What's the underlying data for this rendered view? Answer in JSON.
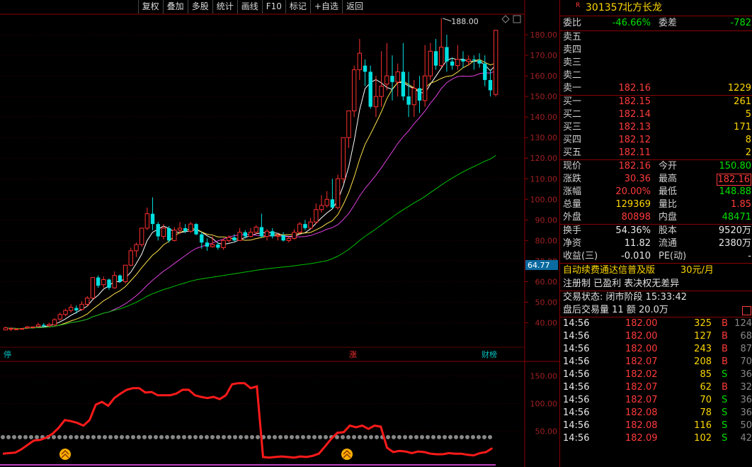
{
  "toolbar": [
    "复权",
    "叠加",
    "多股",
    "统计",
    "画线",
    "F10",
    "标记",
    "+自选",
    "返回"
  ],
  "chart": {
    "y_labels": [
      "180.00",
      "170.00",
      "160.00",
      "150.00",
      "140.00",
      "130.00",
      "120.00",
      "110.00",
      "100.00",
      "90.00",
      "80.00",
      "70.00",
      "60.00",
      "50.00",
      "40.00"
    ],
    "high_label": "188.00",
    "cur_price_tag": "64.77",
    "markers": {
      "stop": "停",
      "zhang": "涨",
      "caibang": "财榜"
    },
    "indicator_labels": [
      "150.00",
      "100.00",
      "50.00"
    ]
  },
  "chart_data": {
    "type": "candlestick",
    "ylim": [
      35,
      190
    ],
    "candles": [
      [
        36.5,
        37.5,
        36.8,
        38.2
      ],
      [
        36.8,
        37.2,
        36.0,
        37.8
      ],
      [
        37.0,
        37.0,
        36.5,
        37.4
      ],
      [
        37.2,
        37.2,
        37.2,
        37.2
      ],
      [
        37.5,
        38.0,
        37.2,
        38.5
      ],
      [
        38.0,
        38.0,
        38.0,
        38.0
      ],
      [
        38.2,
        39.0,
        37.8,
        40.0
      ],
      [
        39.0,
        38.5,
        37.5,
        39.8
      ],
      [
        38.6,
        39.2,
        38.0,
        40.0
      ],
      [
        39.0,
        41.5,
        38.5,
        42.3
      ],
      [
        41.8,
        44.0,
        41.0,
        45.0
      ],
      [
        44.0,
        46.0,
        43.2,
        46.8
      ],
      [
        46.0,
        47.5,
        45.0,
        49.0
      ],
      [
        47.2,
        46.0,
        44.5,
        48.5
      ],
      [
        46.5,
        49.0,
        45.8,
        50.5
      ],
      [
        49.0,
        52.0,
        48.0,
        53.0
      ],
      [
        52.0,
        62.0,
        51.5,
        62.0
      ],
      [
        62.0,
        58.0,
        57.0,
        63.0
      ],
      [
        58.5,
        61.0,
        57.0,
        62.5
      ],
      [
        61.0,
        57.0,
        56.0,
        61.5
      ],
      [
        57.0,
        63.0,
        56.5,
        65.0
      ],
      [
        63.0,
        60.0,
        59.5,
        63.5
      ],
      [
        60.0,
        68.0,
        59.0,
        68.0
      ],
      [
        68.0,
        75.0,
        67.5,
        76.5
      ],
      [
        75.0,
        78.0,
        72.0,
        79.0
      ],
      [
        78.0,
        86.0,
        77.0,
        86.0
      ],
      [
        86.0,
        93.0,
        85.0,
        96.0
      ],
      [
        93.0,
        88.0,
        85.0,
        101.0
      ],
      [
        88.0,
        82.0,
        80.0,
        89.0
      ],
      [
        82.0,
        86.0,
        80.5,
        88.0
      ],
      [
        86.0,
        80.0,
        79.0,
        87.0
      ],
      [
        80.0,
        85.0,
        79.5,
        86.5
      ],
      [
        85.0,
        86.0,
        83.0,
        89.0
      ],
      [
        86.0,
        84.5,
        83.5,
        88.0
      ],
      [
        84.5,
        88.0,
        83.8,
        89.0
      ],
      [
        88.0,
        83.0,
        82.5,
        88.5
      ],
      [
        83.0,
        79.0,
        76.0,
        84.0
      ],
      [
        79.0,
        77.0,
        75.0,
        81.0
      ],
      [
        77.0,
        78.0,
        76.5,
        82.0
      ],
      [
        78.0,
        76.5,
        75.5,
        79.0
      ],
      [
        76.5,
        80.0,
        75.5,
        81.0
      ],
      [
        80.0,
        81.5,
        79.0,
        82.5
      ],
      [
        81.5,
        80.0,
        79.5,
        83.0
      ],
      [
        80.0,
        84.0,
        79.8,
        86.0
      ],
      [
        84.0,
        82.0,
        81.0,
        85.0
      ],
      [
        82.0,
        84.0,
        81.5,
        86.0
      ],
      [
        84.0,
        86.5,
        83.0,
        87.5
      ],
      [
        86.5,
        82.0,
        81.5,
        93.0
      ],
      [
        82.0,
        84.5,
        80.0,
        85.5
      ],
      [
        84.5,
        82.0,
        81.0,
        86.0
      ],
      [
        82.0,
        82.5,
        80.0,
        83.5
      ],
      [
        82.5,
        80.0,
        79.5,
        84.0
      ],
      [
        80.0,
        81.0,
        79.0,
        82.0
      ],
      [
        81.0,
        84.0,
        80.5,
        85.5
      ],
      [
        84.0,
        88.0,
        83.0,
        89.0
      ],
      [
        88.0,
        86.0,
        85.0,
        90.0
      ],
      [
        86.0,
        89.0,
        85.5,
        91.0
      ],
      [
        89.0,
        95.0,
        88.0,
        98.0
      ],
      [
        95.0,
        97.0,
        93.5,
        102.0
      ],
      [
        97.0,
        100.0,
        96.0,
        104.0
      ],
      [
        100.0,
        96.0,
        95.5,
        110.0
      ],
      [
        96.0,
        110.0,
        95.0,
        112.0
      ],
      [
        110.0,
        130.0,
        108.0,
        130.0
      ],
      [
        130.0,
        143.0,
        125.0,
        143.0
      ],
      [
        143.0,
        163.0,
        140.0,
        165.0
      ],
      [
        163.0,
        171.0,
        158.0,
        178.0
      ],
      [
        165.0,
        162.0,
        155.0,
        168.0
      ],
      [
        162.0,
        145.0,
        144.0,
        165.0
      ],
      [
        145.0,
        150.0,
        140.0,
        160.0
      ],
      [
        150.0,
        155.0,
        145.0,
        172.0
      ],
      [
        156.0,
        160.0,
        153.0,
        176.0
      ],
      [
        160.0,
        157.0,
        148.0,
        170.0
      ],
      [
        157.0,
        162.0,
        150.0,
        166.0
      ],
      [
        162.0,
        150.0,
        148.0,
        176.0
      ],
      [
        150.0,
        146.0,
        140.0,
        162.0
      ],
      [
        146.0,
        154.0,
        140.0,
        158.0
      ],
      [
        154.0,
        148.0,
        142.0,
        160.0
      ],
      [
        148.0,
        160.0,
        145.0,
        175.0
      ],
      [
        160.0,
        172.0,
        158.0,
        176.0
      ],
      [
        172.0,
        165.0,
        163.0,
        178.0
      ],
      [
        165.0,
        174.0,
        164.0,
        188.0
      ],
      [
        174.0,
        167.0,
        162.0,
        180.0
      ],
      [
        167.0,
        165.0,
        163.0,
        169.0
      ],
      [
        165.0,
        168.0,
        163.0,
        175.0
      ],
      [
        168.0,
        167.0,
        164.0,
        172.0
      ],
      [
        167.0,
        168.0,
        165.0,
        170.0
      ],
      [
        168.0,
        167.5,
        163.0,
        170.0
      ],
      [
        167.5,
        166.0,
        164.0,
        171.0
      ],
      [
        166.0,
        158.0,
        155.0,
        170.0
      ],
      [
        158.0,
        153.0,
        150.0,
        163.0
      ],
      [
        151.0,
        182.16,
        150.0,
        182.16
      ]
    ],
    "indicator": [
      9,
      10,
      11,
      17,
      25,
      33,
      34,
      38,
      45,
      56,
      70,
      68,
      65,
      60,
      70,
      98,
      103,
      96,
      110,
      118,
      125,
      128,
      128,
      120,
      121,
      115,
      115,
      115,
      118,
      125,
      125,
      115,
      112,
      110,
      112,
      108,
      115,
      135,
      137,
      137,
      128,
      131,
      3,
      2,
      3,
      4,
      3,
      2,
      4,
      3,
      5,
      9,
      22,
      36,
      47,
      48,
      60,
      57,
      60,
      54,
      60,
      58,
      20,
      12,
      14,
      13,
      10,
      13,
      12,
      9,
      8,
      8,
      10,
      9,
      9,
      7,
      6,
      10,
      12,
      19
    ]
  },
  "side": {
    "code": "301357",
    "name": "北方长龙",
    "r_badge": "R",
    "weibi_label": "委比",
    "weibi": "-46.66%",
    "weicha_label": "委差",
    "weicha": "-782",
    "asks": [
      {
        "label": "卖五",
        "price": "",
        "vol": ""
      },
      {
        "label": "卖四",
        "price": "",
        "vol": ""
      },
      {
        "label": "卖三",
        "price": "",
        "vol": ""
      },
      {
        "label": "卖二",
        "price": "",
        "vol": ""
      },
      {
        "label": "卖一",
        "price": "182.16",
        "vol": "1229"
      }
    ],
    "bids": [
      {
        "label": "买一",
        "price": "182.15",
        "vol": "261"
      },
      {
        "label": "买二",
        "price": "182.14",
        "vol": "5"
      },
      {
        "label": "买三",
        "price": "182.13",
        "vol": "171"
      },
      {
        "label": "买四",
        "price": "182.12",
        "vol": "8"
      },
      {
        "label": "买五",
        "price": "182.11",
        "vol": "2"
      }
    ],
    "stats": [
      {
        "l1": "现价",
        "v1": "182.16",
        "c1": "red",
        "l2": "今开",
        "v2": "150.80",
        "c2": "green"
      },
      {
        "l1": "涨跌",
        "v1": "30.36",
        "c1": "red",
        "l2": "最高",
        "v2": "182.16",
        "c2": "red"
      },
      {
        "l1": "涨幅",
        "v1": "20.00%",
        "c1": "red",
        "l2": "最低",
        "v2": "148.88",
        "c2": "green"
      },
      {
        "l1": "总量",
        "v1": "129369",
        "c1": "yellow",
        "l2": "量比",
        "v2": "1.85",
        "c2": "red"
      },
      {
        "l1": "外盘",
        "v1": "80898",
        "c1": "red",
        "l2": "内盘",
        "v2": "48471",
        "c2": "green"
      }
    ],
    "stats2": [
      {
        "l1": "换手",
        "v1": "54.36%",
        "l2": "股本",
        "v2": "9520万"
      },
      {
        "l1": "净资",
        "v1": "11.82",
        "l2": "流通",
        "v2": "2380万"
      },
      {
        "l1": "收益(三)",
        "v1": "-0.010",
        "l2": "PE(动)",
        "v2": "-"
      }
    ],
    "promo": "自动续费通达信普及版",
    "promo_price": "30元/月",
    "reg_line": "注册制 已盈利 表决权无差异",
    "trade_status": "交易状态: 闭市阶段 15:33:42",
    "after_hours": "盘后交易量 11 额 20.0万",
    "ticks": [
      {
        "t": "14:56",
        "p": "182.00",
        "v": "325",
        "d": "B",
        "n": "124"
      },
      {
        "t": "14:56",
        "p": "182.00",
        "v": "127",
        "d": "B",
        "n": "68"
      },
      {
        "t": "14:56",
        "p": "182.00",
        "v": "243",
        "d": "B",
        "n": "87"
      },
      {
        "t": "14:56",
        "p": "182.07",
        "v": "208",
        "d": "B",
        "n": "70"
      },
      {
        "t": "14:56",
        "p": "182.02",
        "v": "85",
        "d": "S",
        "n": "36"
      },
      {
        "t": "14:56",
        "p": "182.07",
        "v": "62",
        "d": "B",
        "n": "32"
      },
      {
        "t": "14:56",
        "p": "182.07",
        "v": "70",
        "d": "S",
        "n": "36"
      },
      {
        "t": "14:56",
        "p": "182.08",
        "v": "78",
        "d": "S",
        "n": "36"
      },
      {
        "t": "14:56",
        "p": "182.08",
        "v": "116",
        "d": "S",
        "n": "50"
      },
      {
        "t": "14:56",
        "p": "182.09",
        "v": "102",
        "d": "S",
        "n": "42"
      }
    ]
  }
}
